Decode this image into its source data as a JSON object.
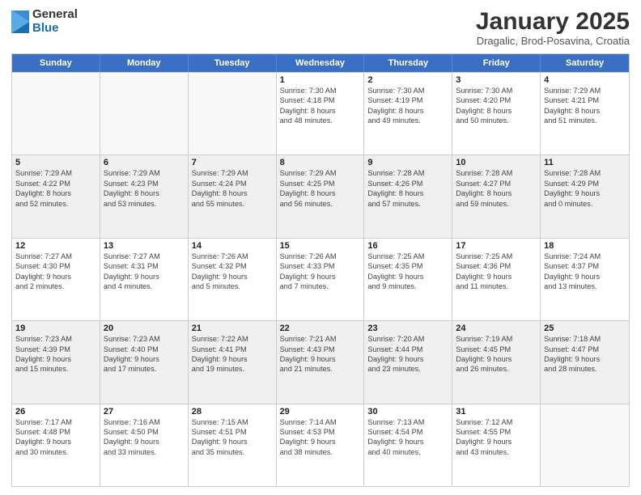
{
  "logo": {
    "general": "General",
    "blue": "Blue"
  },
  "header": {
    "month": "January 2025",
    "location": "Dragalic, Brod-Posavina, Croatia"
  },
  "weekdays": [
    "Sunday",
    "Monday",
    "Tuesday",
    "Wednesday",
    "Thursday",
    "Friday",
    "Saturday"
  ],
  "rows": [
    [
      {
        "day": "",
        "info": "",
        "empty": true
      },
      {
        "day": "",
        "info": "",
        "empty": true
      },
      {
        "day": "",
        "info": "",
        "empty": true
      },
      {
        "day": "1",
        "info": "Sunrise: 7:30 AM\nSunset: 4:18 PM\nDaylight: 8 hours\nand 48 minutes.",
        "empty": false
      },
      {
        "day": "2",
        "info": "Sunrise: 7:30 AM\nSunset: 4:19 PM\nDaylight: 8 hours\nand 49 minutes.",
        "empty": false
      },
      {
        "day": "3",
        "info": "Sunrise: 7:30 AM\nSunset: 4:20 PM\nDaylight: 8 hours\nand 50 minutes.",
        "empty": false
      },
      {
        "day": "4",
        "info": "Sunrise: 7:29 AM\nSunset: 4:21 PM\nDaylight: 8 hours\nand 51 minutes.",
        "empty": false
      }
    ],
    [
      {
        "day": "5",
        "info": "Sunrise: 7:29 AM\nSunset: 4:22 PM\nDaylight: 8 hours\nand 52 minutes.",
        "empty": false
      },
      {
        "day": "6",
        "info": "Sunrise: 7:29 AM\nSunset: 4:23 PM\nDaylight: 8 hours\nand 53 minutes.",
        "empty": false
      },
      {
        "day": "7",
        "info": "Sunrise: 7:29 AM\nSunset: 4:24 PM\nDaylight: 8 hours\nand 55 minutes.",
        "empty": false
      },
      {
        "day": "8",
        "info": "Sunrise: 7:29 AM\nSunset: 4:25 PM\nDaylight: 8 hours\nand 56 minutes.",
        "empty": false
      },
      {
        "day": "9",
        "info": "Sunrise: 7:28 AM\nSunset: 4:26 PM\nDaylight: 8 hours\nand 57 minutes.",
        "empty": false
      },
      {
        "day": "10",
        "info": "Sunrise: 7:28 AM\nSunset: 4:27 PM\nDaylight: 8 hours\nand 59 minutes.",
        "empty": false
      },
      {
        "day": "11",
        "info": "Sunrise: 7:28 AM\nSunset: 4:29 PM\nDaylight: 9 hours\nand 0 minutes.",
        "empty": false
      }
    ],
    [
      {
        "day": "12",
        "info": "Sunrise: 7:27 AM\nSunset: 4:30 PM\nDaylight: 9 hours\nand 2 minutes.",
        "empty": false
      },
      {
        "day": "13",
        "info": "Sunrise: 7:27 AM\nSunset: 4:31 PM\nDaylight: 9 hours\nand 4 minutes.",
        "empty": false
      },
      {
        "day": "14",
        "info": "Sunrise: 7:26 AM\nSunset: 4:32 PM\nDaylight: 9 hours\nand 5 minutes.",
        "empty": false
      },
      {
        "day": "15",
        "info": "Sunrise: 7:26 AM\nSunset: 4:33 PM\nDaylight: 9 hours\nand 7 minutes.",
        "empty": false
      },
      {
        "day": "16",
        "info": "Sunrise: 7:25 AM\nSunset: 4:35 PM\nDaylight: 9 hours\nand 9 minutes.",
        "empty": false
      },
      {
        "day": "17",
        "info": "Sunrise: 7:25 AM\nSunset: 4:36 PM\nDaylight: 9 hours\nand 11 minutes.",
        "empty": false
      },
      {
        "day": "18",
        "info": "Sunrise: 7:24 AM\nSunset: 4:37 PM\nDaylight: 9 hours\nand 13 minutes.",
        "empty": false
      }
    ],
    [
      {
        "day": "19",
        "info": "Sunrise: 7:23 AM\nSunset: 4:39 PM\nDaylight: 9 hours\nand 15 minutes.",
        "empty": false
      },
      {
        "day": "20",
        "info": "Sunrise: 7:23 AM\nSunset: 4:40 PM\nDaylight: 9 hours\nand 17 minutes.",
        "empty": false
      },
      {
        "day": "21",
        "info": "Sunrise: 7:22 AM\nSunset: 4:41 PM\nDaylight: 9 hours\nand 19 minutes.",
        "empty": false
      },
      {
        "day": "22",
        "info": "Sunrise: 7:21 AM\nSunset: 4:43 PM\nDaylight: 9 hours\nand 21 minutes.",
        "empty": false
      },
      {
        "day": "23",
        "info": "Sunrise: 7:20 AM\nSunset: 4:44 PM\nDaylight: 9 hours\nand 23 minutes.",
        "empty": false
      },
      {
        "day": "24",
        "info": "Sunrise: 7:19 AM\nSunset: 4:45 PM\nDaylight: 9 hours\nand 26 minutes.",
        "empty": false
      },
      {
        "day": "25",
        "info": "Sunrise: 7:18 AM\nSunset: 4:47 PM\nDaylight: 9 hours\nand 28 minutes.",
        "empty": false
      }
    ],
    [
      {
        "day": "26",
        "info": "Sunrise: 7:17 AM\nSunset: 4:48 PM\nDaylight: 9 hours\nand 30 minutes.",
        "empty": false
      },
      {
        "day": "27",
        "info": "Sunrise: 7:16 AM\nSunset: 4:50 PM\nDaylight: 9 hours\nand 33 minutes.",
        "empty": false
      },
      {
        "day": "28",
        "info": "Sunrise: 7:15 AM\nSunset: 4:51 PM\nDaylight: 9 hours\nand 35 minutes.",
        "empty": false
      },
      {
        "day": "29",
        "info": "Sunrise: 7:14 AM\nSunset: 4:53 PM\nDaylight: 9 hours\nand 38 minutes.",
        "empty": false
      },
      {
        "day": "30",
        "info": "Sunrise: 7:13 AM\nSunset: 4:54 PM\nDaylight: 9 hours\nand 40 minutes.",
        "empty": false
      },
      {
        "day": "31",
        "info": "Sunrise: 7:12 AM\nSunset: 4:55 PM\nDaylight: 9 hours\nand 43 minutes.",
        "empty": false
      },
      {
        "day": "",
        "info": "",
        "empty": true
      }
    ]
  ]
}
